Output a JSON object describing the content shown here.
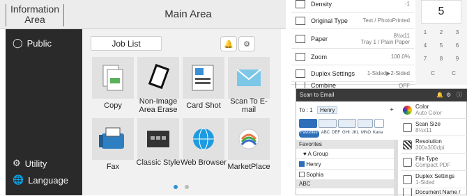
{
  "main_panel": {
    "info_area_label": "Information Area",
    "main_area_label": "Main Area",
    "sidebar": {
      "public": "Public",
      "utility": "Utility",
      "language": "Language"
    },
    "job_list": "Job List",
    "tiles": [
      "Copy",
      "Non-Image Area Erase",
      "Card Shot",
      "Scan To E-mail",
      "Fax",
      "Classic Style",
      "Web Browser",
      "MarketPlace"
    ],
    "page_dots": 2
  },
  "copy_settings": {
    "rows": [
      {
        "name": "Density",
        "value": "-1"
      },
      {
        "name": "Original Type",
        "value": "Text / PhotoPrinted"
      },
      {
        "name": "Paper",
        "value": "8½x11",
        "value2": "Tray 1 / Plain Paper"
      },
      {
        "name": "Zoom",
        "value": "100.0%"
      },
      {
        "name": "Duplex Settings",
        "value": "1-Sided▶2-Sided"
      },
      {
        "name": "Combine",
        "value": "OFF"
      }
    ],
    "count": "5",
    "keys": [
      "1",
      "2",
      "3",
      "4",
      "5",
      "6",
      "7",
      "8",
      "9",
      "C",
      "C"
    ]
  },
  "scan_email": {
    "title": "Scan to Email",
    "to_label": "To : 1",
    "to_value": "Henry",
    "plus": "+",
    "index_tabs": [
      "Favorites",
      "ABC",
      "DEF",
      "GHI",
      "JKL",
      "MNO",
      "Kana"
    ],
    "list": [
      {
        "label": "Favorites",
        "type": "header"
      },
      {
        "label": "A Group",
        "type": "group"
      },
      {
        "label": "Henry",
        "type": "checked"
      },
      {
        "label": "Sophia",
        "type": "unchecked"
      },
      {
        "label": "ABC",
        "type": "header"
      }
    ],
    "settings": [
      {
        "name": "Color",
        "value": "Auto Color"
      },
      {
        "name": "Scan Size",
        "value": "8½x11"
      },
      {
        "name": "Resolution",
        "value": "300x300dpi"
      },
      {
        "name": "File Type",
        "value": "Compact PDF"
      },
      {
        "name": "Duplex Settings",
        "value": "1-Sided"
      },
      {
        "name": "Document Name /",
        "value": ""
      }
    ]
  }
}
